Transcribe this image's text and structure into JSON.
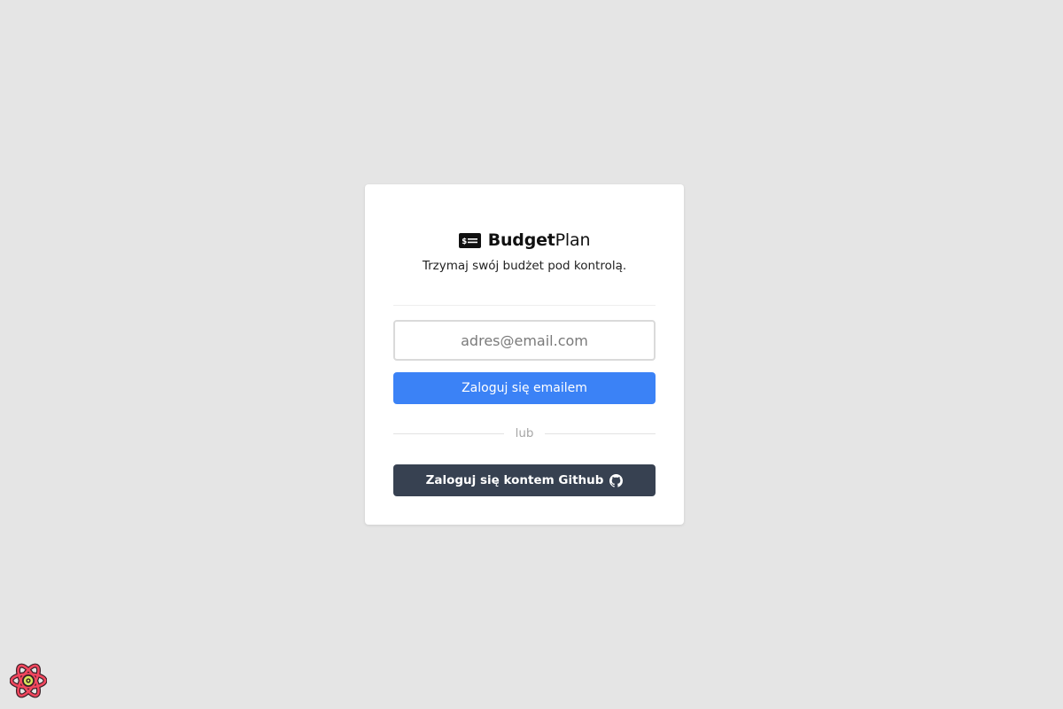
{
  "brand": {
    "name_bold": "Budget",
    "name_light": "Plan",
    "icon": "money-check-icon"
  },
  "tagline": "Trzymaj swój budżet pod kontrolą.",
  "email": {
    "placeholder": "adres@email.com",
    "value": ""
  },
  "buttons": {
    "email_login": "Zaloguj się emailem",
    "github_login": "Zaloguj się kontem Github"
  },
  "separator_label": "lub",
  "icons": {
    "github": "github-icon",
    "devtools": "react-devtools-icon"
  },
  "colors": {
    "background": "#e5e5e5",
    "card": "#ffffff",
    "primary": "#3b82f6",
    "github": "#374151"
  }
}
